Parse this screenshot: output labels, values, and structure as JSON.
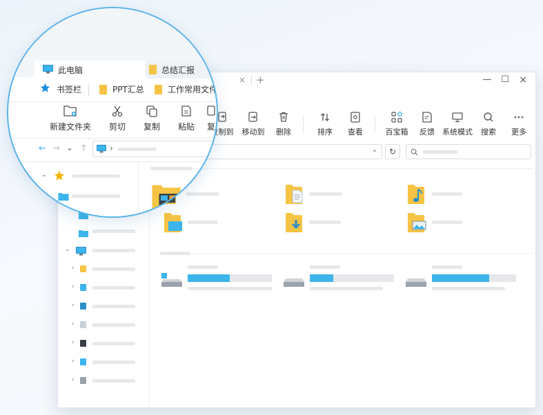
{
  "colors": {
    "accent": "#3cb4ec",
    "folder": "#f6c444",
    "star": "#f5b400",
    "progress_fill": "#3cb4ec"
  },
  "tabs": [
    {
      "label": "此电脑",
      "icon": "computer-icon",
      "active": true
    },
    {
      "label": "总结汇报",
      "icon": "folder-icon",
      "active": false
    }
  ],
  "bookmarks": {
    "bar_label": "书签栏",
    "items": [
      {
        "label": "PPT汇总",
        "icon": "folder-icon"
      },
      {
        "label": "工作常用文件",
        "icon": "folder-icon"
      }
    ]
  },
  "toolbar": {
    "new_folder": "新建文件夹",
    "cut": "剪切",
    "copy": "复制",
    "paste": "粘贴",
    "copy_partial": "复",
    "copy_to": "复制到",
    "move_to": "移动到",
    "delete": "删除",
    "sort": "排序",
    "view": "查看",
    "toolbox": "百宝箱",
    "feedback": "反馈",
    "system_mode": "系统模式",
    "search": "搜索",
    "more": "更多"
  },
  "window_controls": {
    "tab_close": "×",
    "new_tab": "+",
    "minimize": "—",
    "maximize": "☐",
    "close": "×"
  },
  "address_bar": {
    "back": "←",
    "forward": "→",
    "history": "⌄",
    "up": "↑",
    "separator": "›",
    "dropdown": "⌄",
    "refresh": "↻"
  },
  "drives": [
    {
      "name": "system-drive",
      "used_fraction": 0.5
    },
    {
      "name": "drive-2",
      "used_fraction": 0.28
    },
    {
      "name": "drive-3",
      "used_fraction": 0.68
    }
  ]
}
